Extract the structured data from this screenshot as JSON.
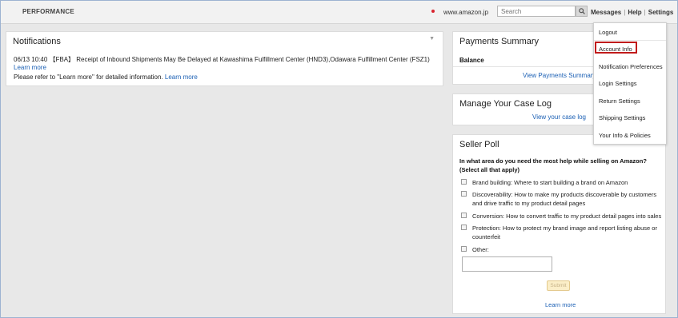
{
  "header": {
    "title": "PERFORMANCE",
    "site": "www.amazon.jp",
    "search_placeholder": "Search",
    "links": {
      "messages": "Messages",
      "help": "Help",
      "settings": "Settings"
    },
    "separator": "|"
  },
  "notifications": {
    "title": "Notifications",
    "message": "06/13 10:40 【FBA】 Receipt of Inbound Shipments May Be Delayed at Kawashima Fulfillment Center (HND3),Odawara Fulfillment Center (FSZ1)",
    "learn_more": "Learn more",
    "refer_text": "Please refer to \"Learn more\" for detailed information.",
    "refer_link": "Learn more"
  },
  "payments": {
    "title": "Payments Summary",
    "balance_label": "Balance",
    "view_link": "View Payments Summary"
  },
  "case_log": {
    "title": "Manage Your Case Log",
    "view_link": "View your case log"
  },
  "poll": {
    "title": "Seller Poll",
    "question": "In what area do you need the most help while selling on Amazon? (Select all that apply)",
    "options": [
      "Brand building: Where to start building a brand on Amazon",
      "Discoverability: How to make my products discoverable by customers and drive traffic to my product detail pages",
      "Conversion: How to convert traffic to my product detail pages into sales",
      "Protection: How to protect my brand image and report listing abuse or counterfeit",
      "Other:"
    ],
    "submit": "Submit",
    "learn_more": "Learn more"
  },
  "settings_menu": {
    "items": [
      "Logout",
      "Account Info",
      "Notification Preferences",
      "Login Settings",
      "Return Settings",
      "Shipping Settings",
      "Your Info & Policies"
    ],
    "highlighted": "Account Info"
  },
  "colors": {
    "link": "#1a5fb4",
    "highlight": "#c11b1b",
    "status_dot": "#d9232e"
  }
}
